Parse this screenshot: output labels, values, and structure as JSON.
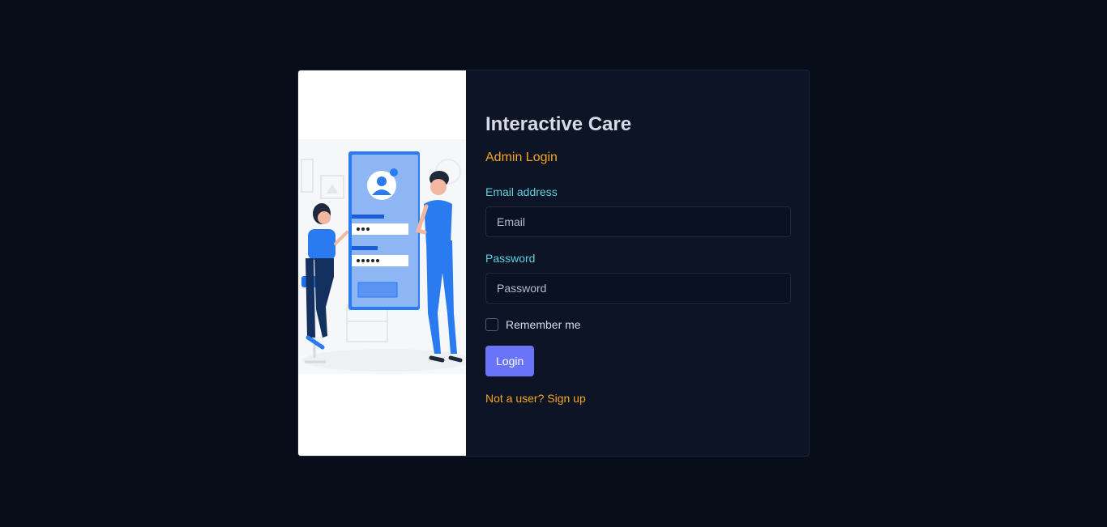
{
  "brand": {
    "title": "Interactive Care",
    "subtitle": "Admin Login"
  },
  "form": {
    "email_label": "Email address",
    "email_placeholder": "Email",
    "email_value": "",
    "password_label": "Password",
    "password_placeholder": "Password",
    "password_value": "",
    "remember_label": "Remember me",
    "remember_checked": false,
    "login_label": "Login",
    "signup_link": "Not a user? Sign up"
  },
  "illustration": {
    "name": "login-illustration"
  },
  "colors": {
    "background": "#070d19",
    "panel": "#0c1426",
    "accent": "#6a74f8",
    "orange": "#f5a623",
    "teal": "#5fd0dc"
  }
}
